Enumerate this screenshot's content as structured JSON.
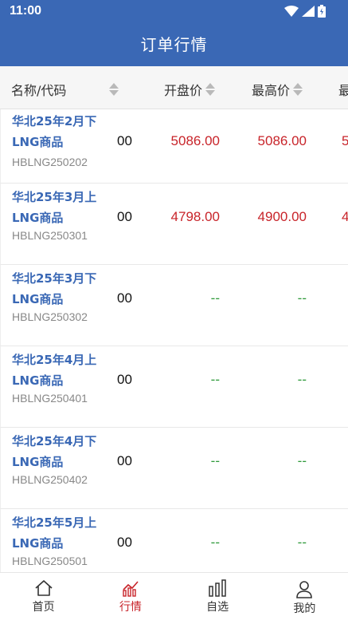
{
  "status": {
    "time": "11:00"
  },
  "header": {
    "title": "订单行情"
  },
  "columns": [
    {
      "label": "名称/代码"
    },
    {
      "label": "开盘价"
    },
    {
      "label": "最高价"
    },
    {
      "label": "最"
    }
  ],
  "rows": [
    {
      "name": "华北25年2月下LNG商品",
      "code": "HBLNG250202",
      "col0": "00",
      "open": "5086.00",
      "high": "5086.00",
      "extra": "5",
      "color": "red"
    },
    {
      "name": "华北25年3月上LNG商品",
      "code": "HBLNG250301",
      "col0": "00",
      "open": "4798.00",
      "high": "4900.00",
      "extra": "4",
      "color": "red"
    },
    {
      "name": "华北25年3月下LNG商品",
      "code": "HBLNG250302",
      "col0": "00",
      "open": "--",
      "high": "--",
      "extra": "",
      "color": "green"
    },
    {
      "name": "华北25年4月上LNG商品",
      "code": "HBLNG250401",
      "col0": "00",
      "open": "--",
      "high": "--",
      "extra": "",
      "color": "green"
    },
    {
      "name": "华北25年4月下LNG商品",
      "code": "HBLNG250402",
      "col0": "00",
      "open": "--",
      "high": "--",
      "extra": "",
      "color": "green"
    },
    {
      "name": "华北25年5月上LNG商品",
      "code": "HBLNG250501",
      "col0": "00",
      "open": "--",
      "high": "--",
      "extra": "",
      "color": "green"
    }
  ],
  "nav": [
    {
      "label": "首页",
      "icon": "home-icon"
    },
    {
      "label": "行情",
      "icon": "chart-icon",
      "active": true
    },
    {
      "label": "自选",
      "icon": "bars-icon"
    },
    {
      "label": "我的",
      "icon": "user-icon"
    }
  ],
  "colors": {
    "brand": "#3a68b5",
    "up": "#c8242a",
    "flat": "#2e9a3a"
  }
}
